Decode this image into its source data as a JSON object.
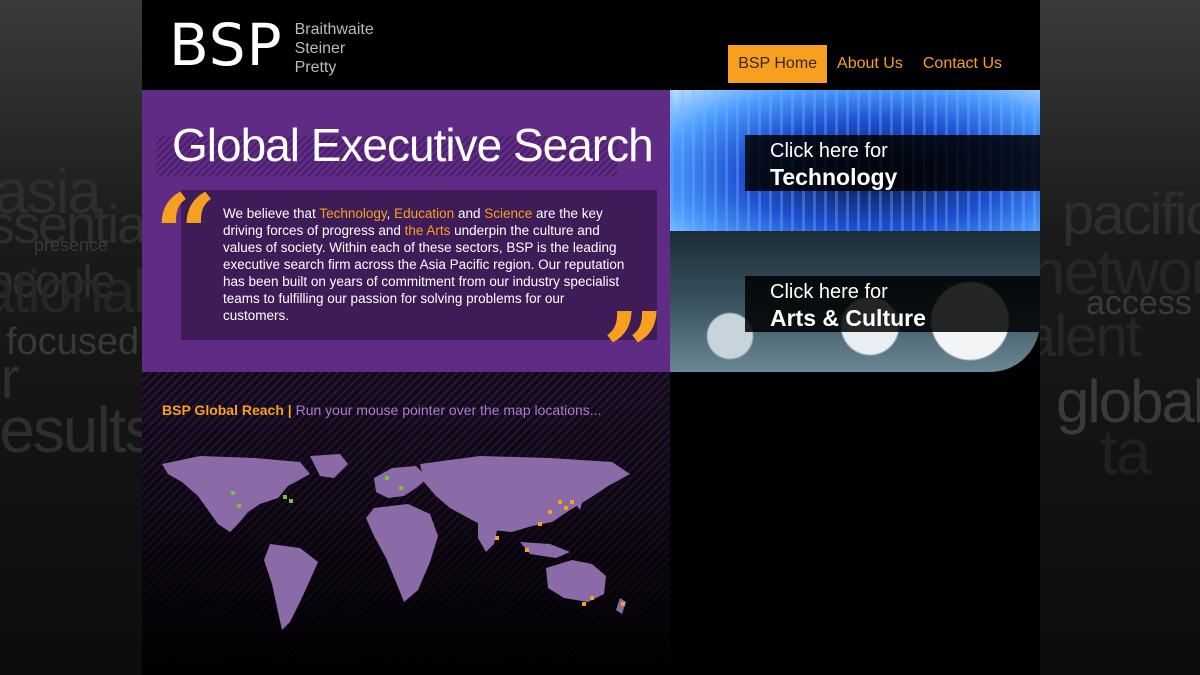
{
  "background_words": {
    "left": [
      "asia",
      "essential",
      "people",
      "national",
      "focused",
      "our",
      "results",
      "presence"
    ],
    "right": [
      "pacific",
      "network",
      "access",
      "talent",
      "global",
      "ta"
    ]
  },
  "header": {
    "logo_mark": "BSP",
    "logo_words": [
      "Braithwaite",
      "Steiner",
      "Pretty"
    ],
    "nav": [
      {
        "label": "BSP Home",
        "active": true
      },
      {
        "label": "About Us",
        "active": false
      },
      {
        "label": "Contact Us",
        "active": false
      }
    ]
  },
  "hero": {
    "title": "Global Executive Search",
    "quote_open": "“",
    "quote_close": "”",
    "text": {
      "p1": "We believe that ",
      "technology": "Technology",
      "c1": ", ",
      "education": "Education",
      "and1": " and ",
      "science": "Science",
      "p2": " are the key driving forces of progress and ",
      "arts": "the Arts",
      "p3": " underpin the culture and values of society. Within each of these sectors, BSP is the leading executive search firm across the Asia Pacific region. Our reputation has been built on years of commitment from our industry specialist teams to fulfilling our passion for solving problems for our customers."
    }
  },
  "tiles": {
    "technology": {
      "line1": "Click here for",
      "line2": "Technology"
    },
    "arts": {
      "line1": "Click here for",
      "line2": "Arts & Culture"
    }
  },
  "map": {
    "title": "BSP Global Reach",
    "separator": "|",
    "subtitle": "Run your mouse pointer over the map locations..."
  },
  "colors": {
    "accent": "#f7a020",
    "purple": "#5f2b85",
    "purple_dark": "#3e1c58",
    "map_land": "#8b6aa8"
  }
}
